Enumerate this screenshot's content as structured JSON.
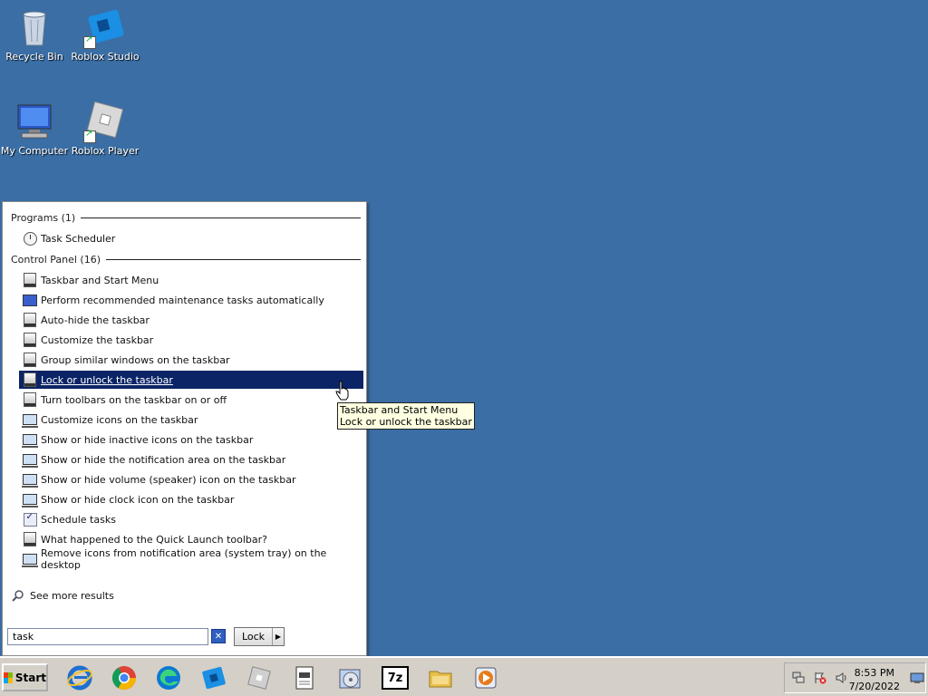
{
  "desktop": {
    "icons": [
      {
        "label": "Recycle Bin"
      },
      {
        "label": "Roblox Studio"
      },
      {
        "label": "My Computer"
      },
      {
        "label": "Roblox Player"
      }
    ]
  },
  "start_menu": {
    "programs_header": "Programs (1)",
    "programs": [
      {
        "label": "Task Scheduler",
        "icon": "clock-icon"
      }
    ],
    "control_panel_header": "Control Panel (16)",
    "control_panel": [
      {
        "label": "Taskbar and Start Menu",
        "icon": "taskbar-icon"
      },
      {
        "label": "Perform recommended maintenance tasks automatically",
        "icon": "maintenance-icon"
      },
      {
        "label": "Auto-hide the taskbar",
        "icon": "taskbar-icon"
      },
      {
        "label": "Customize the taskbar",
        "icon": "taskbar-icon"
      },
      {
        "label": "Group similar windows on the taskbar",
        "icon": "taskbar-icon"
      },
      {
        "label": "Lock or unlock the taskbar",
        "icon": "taskbar-icon",
        "selected": true
      },
      {
        "label": "Turn toolbars on the taskbar on or off",
        "icon": "taskbar-icon"
      },
      {
        "label": "Customize icons on the taskbar",
        "icon": "monitor-icon"
      },
      {
        "label": "Show or hide inactive icons on the taskbar",
        "icon": "monitor-icon"
      },
      {
        "label": "Show or hide the notification area on the taskbar",
        "icon": "monitor-icon"
      },
      {
        "label": "Show or hide volume (speaker) icon on the taskbar",
        "icon": "monitor-icon"
      },
      {
        "label": "Show or hide clock icon on the taskbar",
        "icon": "monitor-icon"
      },
      {
        "label": "Schedule tasks",
        "icon": "schedule-icon"
      },
      {
        "label": "What happened to the Quick Launch toolbar?",
        "icon": "taskbar-icon"
      },
      {
        "label": "Remove icons from notification area (system tray) on the desktop",
        "icon": "monitor-icon"
      }
    ],
    "see_more": "See more results",
    "search_value": "task",
    "lock_button": "Lock",
    "tooltip_line1": "Taskbar and Start Menu",
    "tooltip_line2": "Lock or unlock the taskbar"
  },
  "taskbar": {
    "start_label": "Start",
    "pinned": [
      {
        "name": "internet-explorer-icon",
        "glyph": "e",
        "color": "#1f6fd1"
      },
      {
        "name": "chrome-icon",
        "glyph": "",
        "color": "#db4437"
      },
      {
        "name": "edge-icon",
        "glyph": "e",
        "color": "#0c78d3"
      },
      {
        "name": "roblox-studio-icon",
        "glyph": "",
        "color": "#1a8fe3"
      },
      {
        "name": "roblox-player-icon",
        "glyph": "",
        "color": "#c8c8c8"
      },
      {
        "name": "notepad-icon",
        "glyph": "",
        "color": "#ffffff"
      },
      {
        "name": "media-icon",
        "glyph": "",
        "color": "#5a8fd8"
      },
      {
        "name": "7zip-icon",
        "glyph": "7z",
        "color": "#000000"
      },
      {
        "name": "folder-icon",
        "glyph": "",
        "color": "#e8c04a"
      },
      {
        "name": "media-player-icon",
        "glyph": "▶",
        "color": "#e87a1a"
      }
    ],
    "time": "8:53 PM",
    "date": "7/20/2022"
  }
}
